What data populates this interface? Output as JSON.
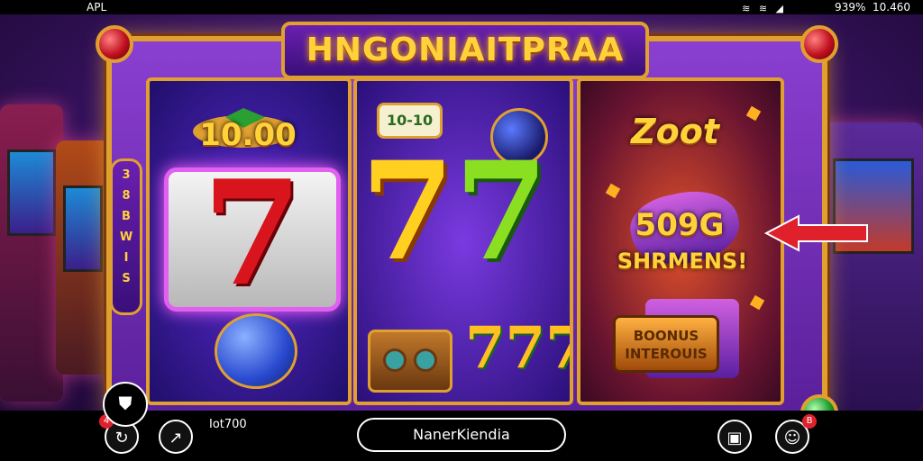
{
  "status_bar": {
    "left": "APL",
    "right_percent": "9̶9̶%",
    "battery_text": "939%",
    "time": "10.460"
  },
  "game": {
    "title": "HNGONIAITPRAA",
    "side_panel": [
      "3",
      "8",
      "B",
      "W",
      "I",
      "S"
    ],
    "reel1": {
      "badge_value": "10.00",
      "center_symbol": "7"
    },
    "reel2": {
      "badge_value": "10-10",
      "big_symbols": [
        "7",
        "7"
      ],
      "small_symbols": "777"
    },
    "reel3": {
      "top_text": "Zoot",
      "win_value": "509G",
      "win_label": "SHRMENS!",
      "bonus_lines": [
        "BOONUS",
        "INTEROUIS"
      ]
    }
  },
  "bottom_bar": {
    "counter": "Iot700",
    "center_pill": "NanerKiendia"
  },
  "colors": {
    "gold": "#e0a030",
    "frame": "#6a1fb0",
    "accent_red": "#e0202a"
  }
}
